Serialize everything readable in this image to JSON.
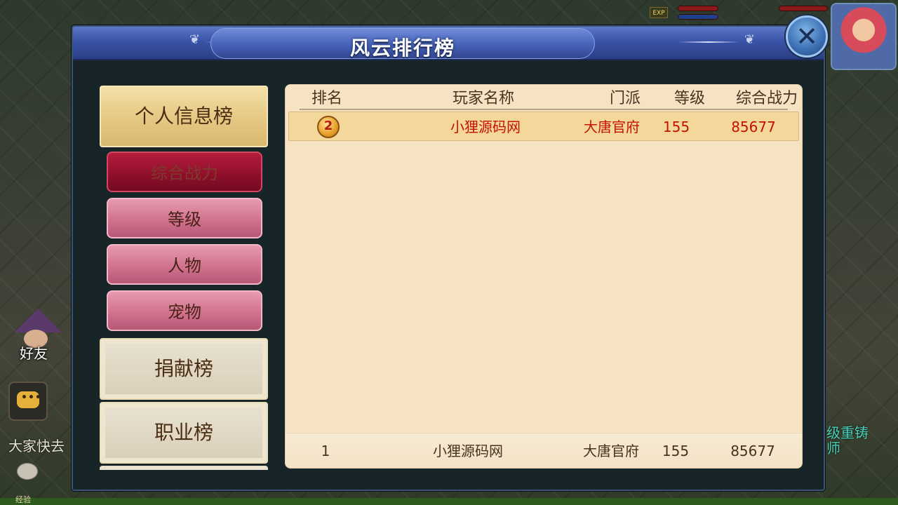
{
  "background": {
    "exp_badge": "EXP",
    "friend_label": "好友",
    "chat_label": "大家快去",
    "right_text_line1": "级重铸",
    "right_text_line2": "师",
    "bottom_exp": "经验"
  },
  "dialog": {
    "title": "风云排行榜",
    "close_icon": "close-icon"
  },
  "nav": {
    "main_items": [
      {
        "label": "个人信息榜",
        "active": true
      },
      {
        "label": "捐献榜",
        "active": false
      },
      {
        "label": "职业榜",
        "active": false
      }
    ],
    "sub_items": [
      {
        "label": "综合战力",
        "selected": true
      },
      {
        "label": "等级",
        "selected": false
      },
      {
        "label": "人物",
        "selected": false
      },
      {
        "label": "宠物",
        "selected": false
      }
    ]
  },
  "table": {
    "headers": [
      "排名",
      "玩家名称",
      "门派",
      "等级",
      "综合战力"
    ],
    "rows": [
      {
        "rank_icon": "gold-medal-icon",
        "name": "小狸源码网",
        "sect": "大唐官府",
        "level": "155",
        "power": "85677"
      }
    ],
    "self_row": {
      "rank": "1",
      "name": "小狸源码网",
      "sect": "大唐官府",
      "level": "155",
      "power": "85677"
    }
  },
  "colors": {
    "title_bar": "#3a53a6",
    "panel_bg": "#f6e3c4",
    "highlight_row": "#f4d79a",
    "red_text": "#c41200",
    "selected_sub": "#8e0f2a"
  }
}
